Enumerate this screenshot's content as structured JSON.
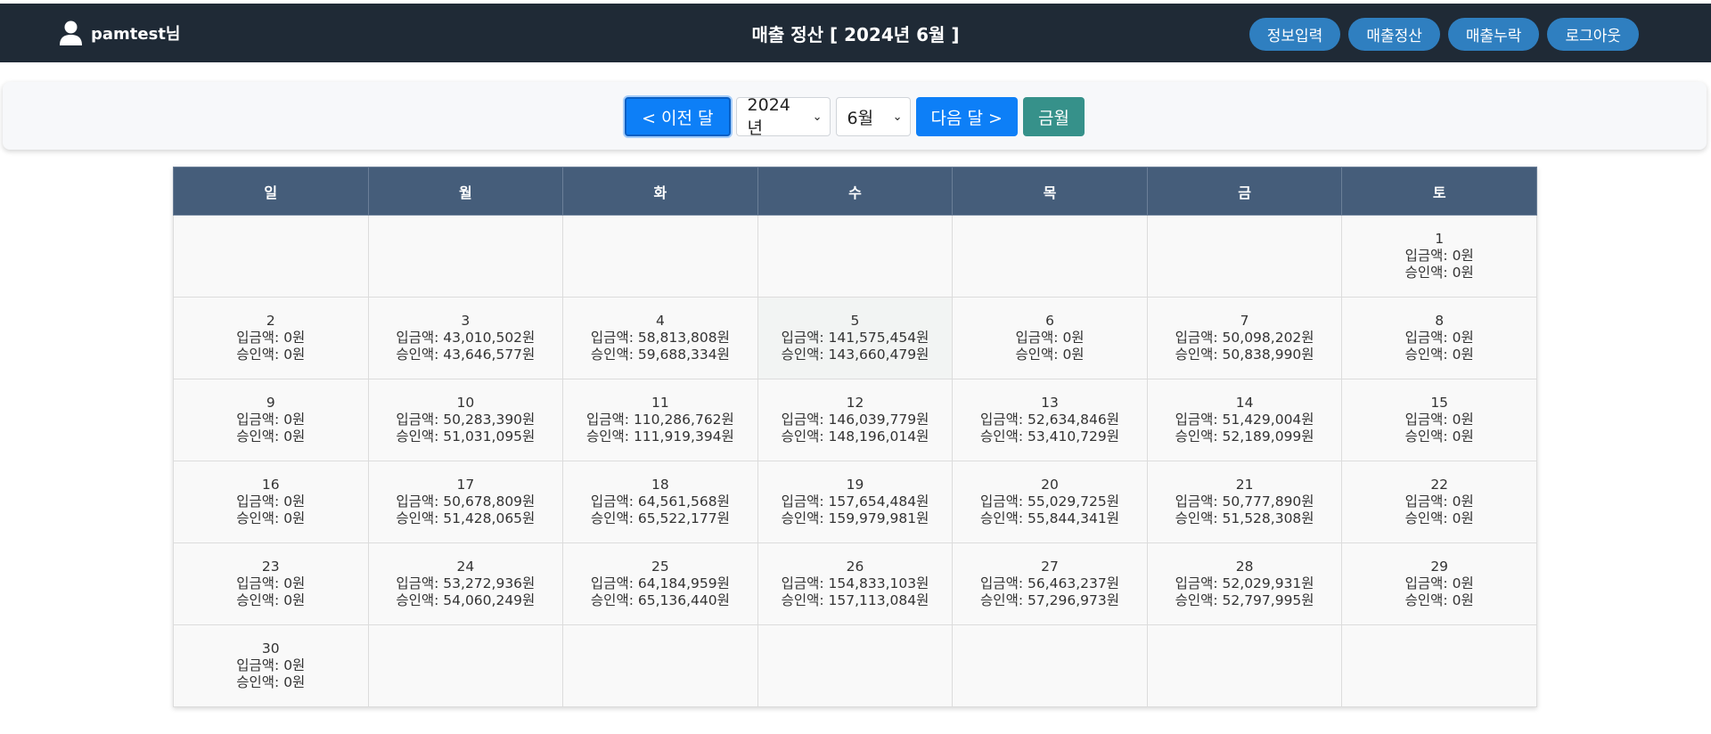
{
  "header": {
    "user_name": "pamtest님",
    "title": "매출 정산 [ 2024년 6월 ]",
    "nav": [
      "정보입력",
      "매출정산",
      "매출누락",
      "로그아웃"
    ]
  },
  "controls": {
    "prev_label": "< 이전 달",
    "year_value": "2024년",
    "month_value": "6월",
    "next_label": "다음 달 >",
    "current_label": "금월"
  },
  "calendar": {
    "weekdays": [
      "일",
      "월",
      "화",
      "수",
      "목",
      "금",
      "토"
    ],
    "deposit_prefix": "입금액: ",
    "approval_prefix": "승인액: ",
    "weeks": [
      [
        null,
        null,
        null,
        null,
        null,
        null,
        {
          "day": "1",
          "deposit": "0원",
          "approval": "0원"
        }
      ],
      [
        {
          "day": "2",
          "deposit": "0원",
          "approval": "0원"
        },
        {
          "day": "3",
          "deposit": "43,010,502원",
          "approval": "43,646,577원"
        },
        {
          "day": "4",
          "deposit": "58,813,808원",
          "approval": "59,688,334원"
        },
        {
          "day": "5",
          "deposit": "141,575,454원",
          "approval": "143,660,479원"
        },
        {
          "day": "6",
          "deposit": "0원",
          "approval": "0원"
        },
        {
          "day": "7",
          "deposit": "50,098,202원",
          "approval": "50,838,990원"
        },
        {
          "day": "8",
          "deposit": "0원",
          "approval": "0원"
        }
      ],
      [
        {
          "day": "9",
          "deposit": "0원",
          "approval": "0원"
        },
        {
          "day": "10",
          "deposit": "50,283,390원",
          "approval": "51,031,095원"
        },
        {
          "day": "11",
          "deposit": "110,286,762원",
          "approval": "111,919,394원"
        },
        {
          "day": "12",
          "deposit": "146,039,779원",
          "approval": "148,196,014원"
        },
        {
          "day": "13",
          "deposit": "52,634,846원",
          "approval": "53,410,729원"
        },
        {
          "day": "14",
          "deposit": "51,429,004원",
          "approval": "52,189,099원"
        },
        {
          "day": "15",
          "deposit": "0원",
          "approval": "0원"
        }
      ],
      [
        {
          "day": "16",
          "deposit": "0원",
          "approval": "0원"
        },
        {
          "day": "17",
          "deposit": "50,678,809원",
          "approval": "51,428,065원"
        },
        {
          "day": "18",
          "deposit": "64,561,568원",
          "approval": "65,522,177원"
        },
        {
          "day": "19",
          "deposit": "157,654,484원",
          "approval": "159,979,981원"
        },
        {
          "day": "20",
          "deposit": "55,029,725원",
          "approval": "55,844,341원"
        },
        {
          "day": "21",
          "deposit": "50,777,890원",
          "approval": "51,528,308원"
        },
        {
          "day": "22",
          "deposit": "0원",
          "approval": "0원"
        }
      ],
      [
        {
          "day": "23",
          "deposit": "0원",
          "approval": "0원"
        },
        {
          "day": "24",
          "deposit": "53,272,936원",
          "approval": "54,060,249원"
        },
        {
          "day": "25",
          "deposit": "64,184,959원",
          "approval": "65,136,440원"
        },
        {
          "day": "26",
          "deposit": "154,833,103원",
          "approval": "157,113,084원"
        },
        {
          "day": "27",
          "deposit": "56,463,237원",
          "approval": "57,296,973원"
        },
        {
          "day": "28",
          "deposit": "52,029,931원",
          "approval": "52,797,995원"
        },
        {
          "day": "29",
          "deposit": "0원",
          "approval": "0원"
        }
      ],
      [
        {
          "day": "30",
          "deposit": "0원",
          "approval": "0원"
        },
        null,
        null,
        null,
        null,
        null,
        null
      ]
    ]
  },
  "colors": {
    "topbar": "#1f2a36",
    "nav_button": "#2f7fc0",
    "primary": "#0d7ff7",
    "teal": "#36918a",
    "calendar_header": "#455d7a"
  }
}
